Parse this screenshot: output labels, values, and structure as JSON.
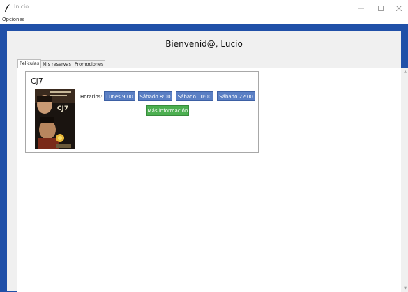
{
  "window": {
    "title": "Inicio"
  },
  "menu": {
    "items": [
      "Opciones"
    ]
  },
  "header": {
    "welcome": "Bienvenid@, Lucio"
  },
  "tabs": [
    {
      "label": "Películas",
      "active": true
    },
    {
      "label": "Mis reservas",
      "active": false
    },
    {
      "label": "Promociones",
      "active": false
    }
  ],
  "movie": {
    "title": "Cj7",
    "poster_title": "CJ7",
    "horarios_label": "Horarios:",
    "slots": [
      "Lunes 9:00",
      "Sábado 8:00",
      "Sábado 10:00",
      "Sábado 22:00"
    ],
    "info_button": "Más información"
  },
  "colors": {
    "frame": "#2050a8",
    "slot_button": "#5a7fc4",
    "info_button": "#4caf50"
  }
}
